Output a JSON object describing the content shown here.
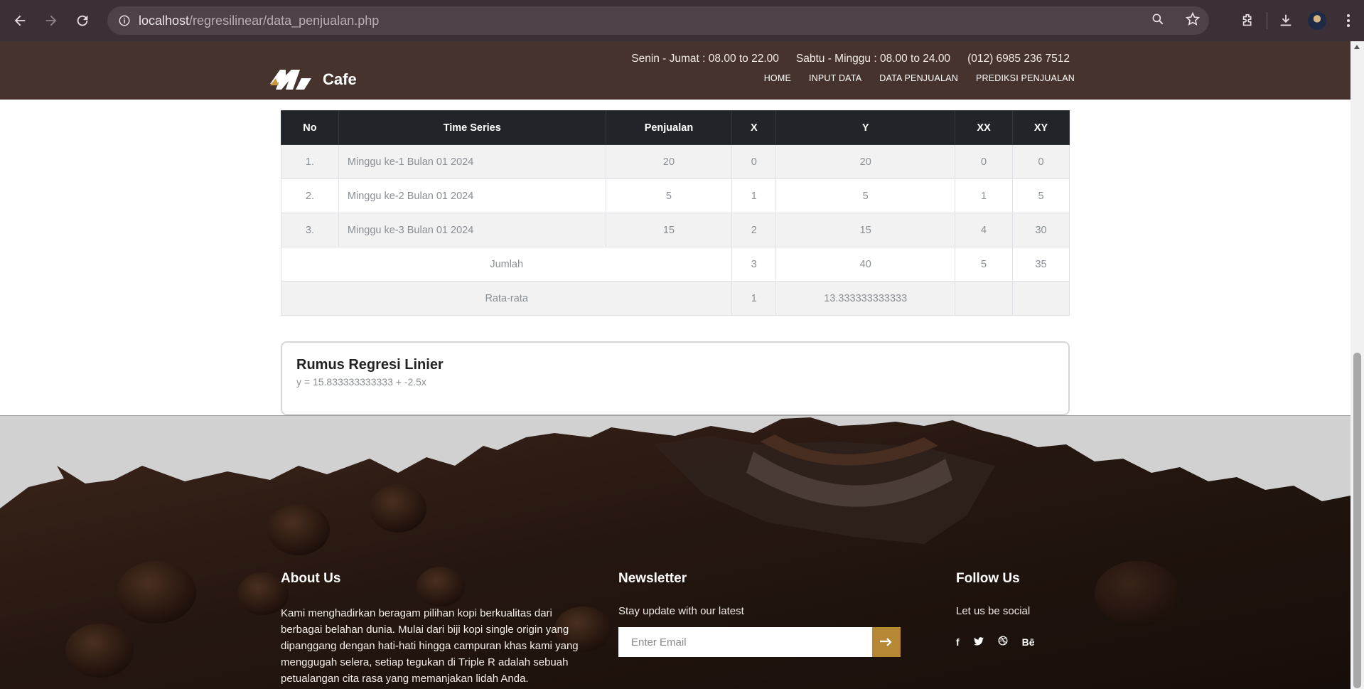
{
  "browser": {
    "url_host": "localhost",
    "url_path": "/regresilinear/data_penjualan.php"
  },
  "header": {
    "logo_text": "Cafe",
    "contact": {
      "weekday": "Senin - Jumat : 08.00 to 22.00",
      "weekend": "Sabtu - Minggu : 08.00 to 24.00",
      "phone": "(012) 6985 236 7512"
    },
    "menu": [
      "HOME",
      "INPUT DATA",
      "DATA PENJUALAN",
      "PREDIKSI PENJUALAN"
    ]
  },
  "table": {
    "headers": [
      "No",
      "Time Series",
      "Penjualan",
      "X",
      "Y",
      "XX",
      "XY"
    ],
    "rows": [
      {
        "no": "1.",
        "time_series": "Minggu ke-1 Bulan 01 2024",
        "penjualan": "20",
        "x": "0",
        "y": "20",
        "xx": "0",
        "xy": "0"
      },
      {
        "no": "2.",
        "time_series": "Minggu ke-2 Bulan 01 2024",
        "penjualan": "5",
        "x": "1",
        "y": "5",
        "xx": "1",
        "xy": "5"
      },
      {
        "no": "3.",
        "time_series": "Minggu ke-3 Bulan 01 2024",
        "penjualan": "15",
        "x": "2",
        "y": "15",
        "xx": "4",
        "xy": "30"
      }
    ],
    "jumlah": {
      "label": "Jumlah",
      "x": "3",
      "y": "40",
      "xx": "5",
      "xy": "35"
    },
    "rata_rata": {
      "label": "Rata-rata",
      "x": "1",
      "y": "13.333333333333",
      "xx": "",
      "xy": ""
    }
  },
  "formula": {
    "title": "Rumus Regresi Linier",
    "equation": "y = 15.833333333333 + -2.5x"
  },
  "footer": {
    "about": {
      "title": "About Us",
      "text": "Kami menghadirkan beragam pilihan kopi berkualitas dari berbagai belahan dunia. Mulai dari biji kopi single origin yang dipanggang dengan hati-hati hingga campuran khas kami yang menggugah selera, setiap tegukan di Triple R adalah sebuah petualangan cita rasa yang memanjakan lidah Anda."
    },
    "newsletter": {
      "title": "Newsletter",
      "subtitle": "Stay update with our latest",
      "placeholder": "Enter Email",
      "button_icon": "arrow-right-icon"
    },
    "follow": {
      "title": "Follow Us",
      "subtitle": "Let us be social",
      "icons": [
        "facebook-icon",
        "twitter-icon",
        "dribbble-icon",
        "behance-icon"
      ],
      "icon_glyphs": [
        "f",
        "t",
        "d",
        "Bē"
      ]
    }
  },
  "colors": {
    "header_bg": "#46332d",
    "table_head": "#212529",
    "accent": "#b68834",
    "chrome": "#3b3035"
  }
}
